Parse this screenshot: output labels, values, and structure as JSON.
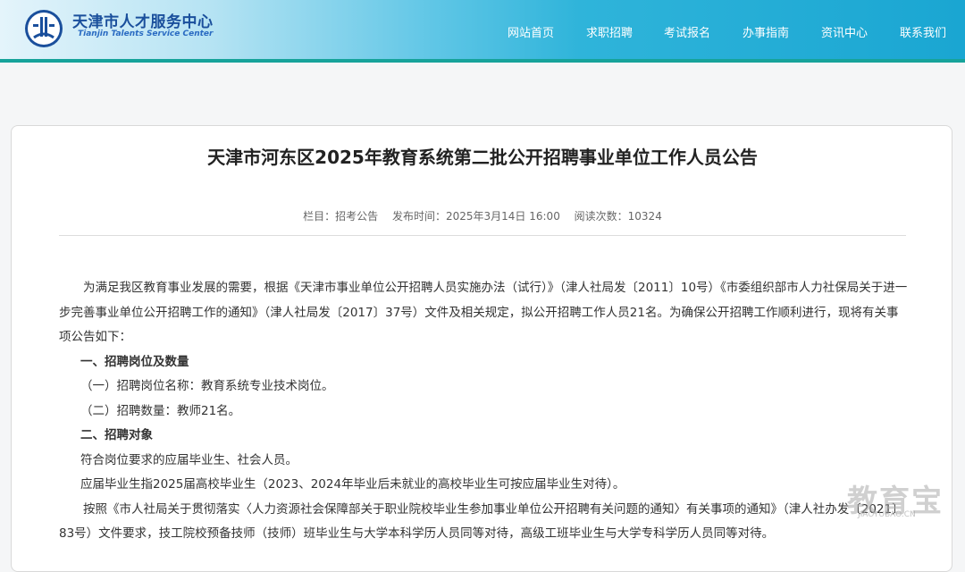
{
  "header": {
    "logo_cn": "天津市人才服务中心",
    "logo_en": "Tianjin Talents Service Center",
    "nav": [
      "网站首页",
      "求职招聘",
      "考试报名",
      "办事指南",
      "资讯中心",
      "联系我们"
    ],
    "accent_color": "#16a39a",
    "brand_color": "#1a4f9c"
  },
  "article": {
    "title": "天津市河东区2025年教育系统第二批公开招聘事业单位工作人员公告",
    "meta": {
      "column": "栏目：招考公告",
      "published": "发布时间：2025年3月14日 16:00",
      "views": "阅读次数：10324"
    },
    "paragraphs": [
      "为满足我区教育事业发展的需要，根据《天津市事业单位公开招聘人员实施办法（试行）》（津人社局发〔2011〕10号）《市委组织部市人力社保局关于进一步完善事业单位公开招聘工作的通知》（津人社局发〔2017〕37号）文件及相关规定，拟公开招聘工作人员21名。为确保公开招聘工作顺利进行，现将有关事项公告如下：",
      "一、招聘岗位及数量",
      "（一）招聘岗位名称：教育系统专业技术岗位。",
      "（二）招聘数量：教师21名。",
      "二、招聘对象",
      "符合岗位要求的应届毕业生、社会人员。",
      "应届毕业生指2025届高校毕业生（2023、2024年毕业后未就业的高校毕业生可按应届毕业生对待）。",
      "按照《市人社局关于贯彻落实〈人力资源社会保障部关于职业院校毕业生参加事业单位公开招聘有关问题的通知〉有关事项的通知》（津人社办发〔2021〕83号）文件要求，技工院校预备技师（技师）班毕业生与大学本科学历人员同等对待，高级工班毕业生与大学专科学历人员同等对待。"
    ]
  },
  "watermark": {
    "cn": "教育宝",
    "en": "JIAOYUBAO.CN"
  }
}
